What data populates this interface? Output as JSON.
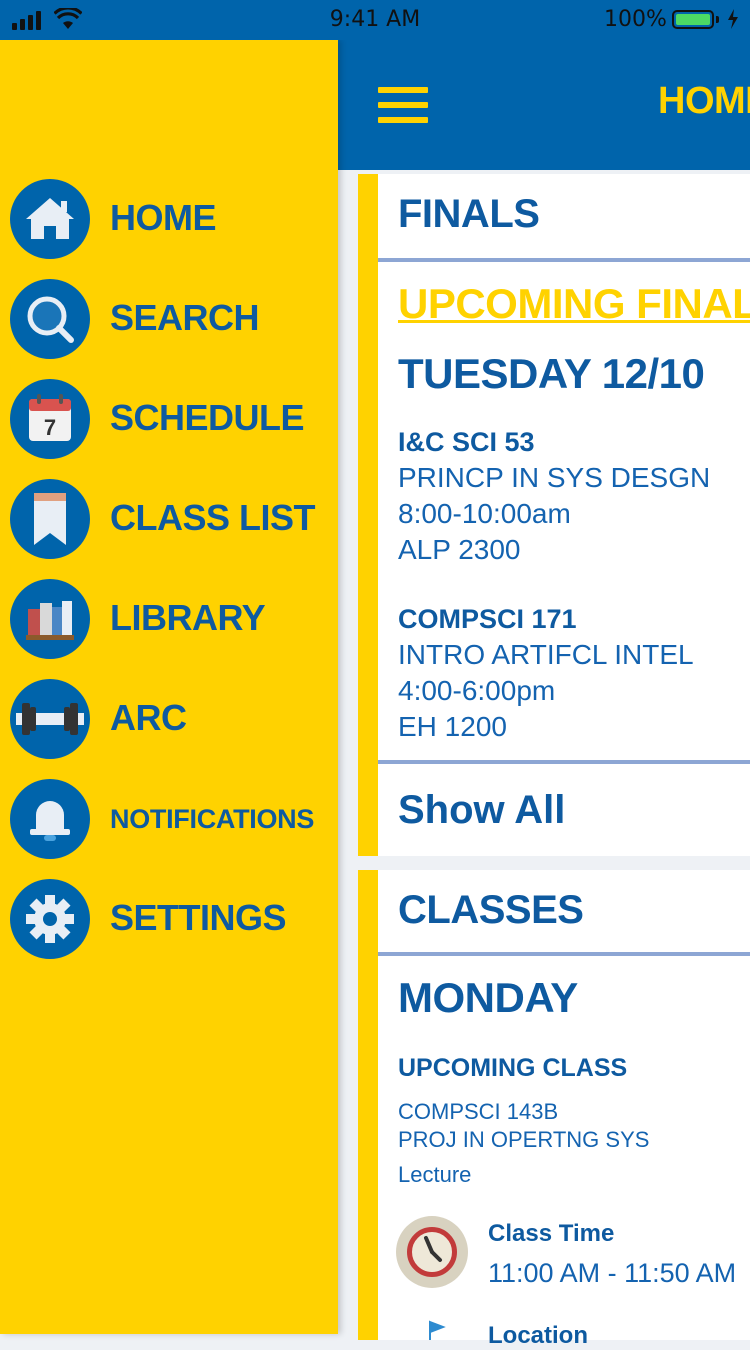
{
  "status_bar": {
    "time": "9:41 AM",
    "battery": "100%"
  },
  "header": {
    "title": "HOME"
  },
  "drawer": {
    "items": [
      {
        "label": "HOME",
        "icon": "home-icon"
      },
      {
        "label": "SEARCH",
        "icon": "search-icon"
      },
      {
        "label": "SCHEDULE",
        "icon": "calendar-icon",
        "calendar_day": "7"
      },
      {
        "label": "CLASS LIST",
        "icon": "bookmark-icon"
      },
      {
        "label": "LIBRARY",
        "icon": "books-icon"
      },
      {
        "label": "ARC",
        "icon": "dumbbell-icon"
      },
      {
        "label": "NOTIFICATIONS",
        "icon": "bell-icon"
      },
      {
        "label": "SETTINGS",
        "icon": "gear-icon"
      }
    ]
  },
  "finals": {
    "title": "FINALS",
    "upcoming": "UPCOMING FINALS",
    "day": "TUESDAY 12/10",
    "courses": [
      {
        "code": "I&C SCI 53",
        "name": "PRINCP IN SYS DESGN",
        "time": "8:00-10:00am",
        "room": "ALP 2300"
      },
      {
        "code": "COMPSCI 171",
        "name": "INTRO ARTIFCL INTEL",
        "time": "4:00-6:00pm",
        "room": "EH 1200"
      }
    ],
    "show_all": "Show All"
  },
  "classes": {
    "title": "CLASSES",
    "day": "MONDAY",
    "upcoming_label": "UPCOMING CLASS",
    "course_code": "COMPSCI 143B",
    "course_name": "PROJ IN OPERTNG SYS",
    "type": "Lecture",
    "time_label": "Class Time",
    "time_value": "11:00 AM - 11:50 AM",
    "location_label": "Location"
  },
  "colors": {
    "brand_blue": "#0064ab",
    "brand_yellow": "#ffd200",
    "text_blue": "#0e5aa0",
    "divider": "#8da6d4"
  }
}
